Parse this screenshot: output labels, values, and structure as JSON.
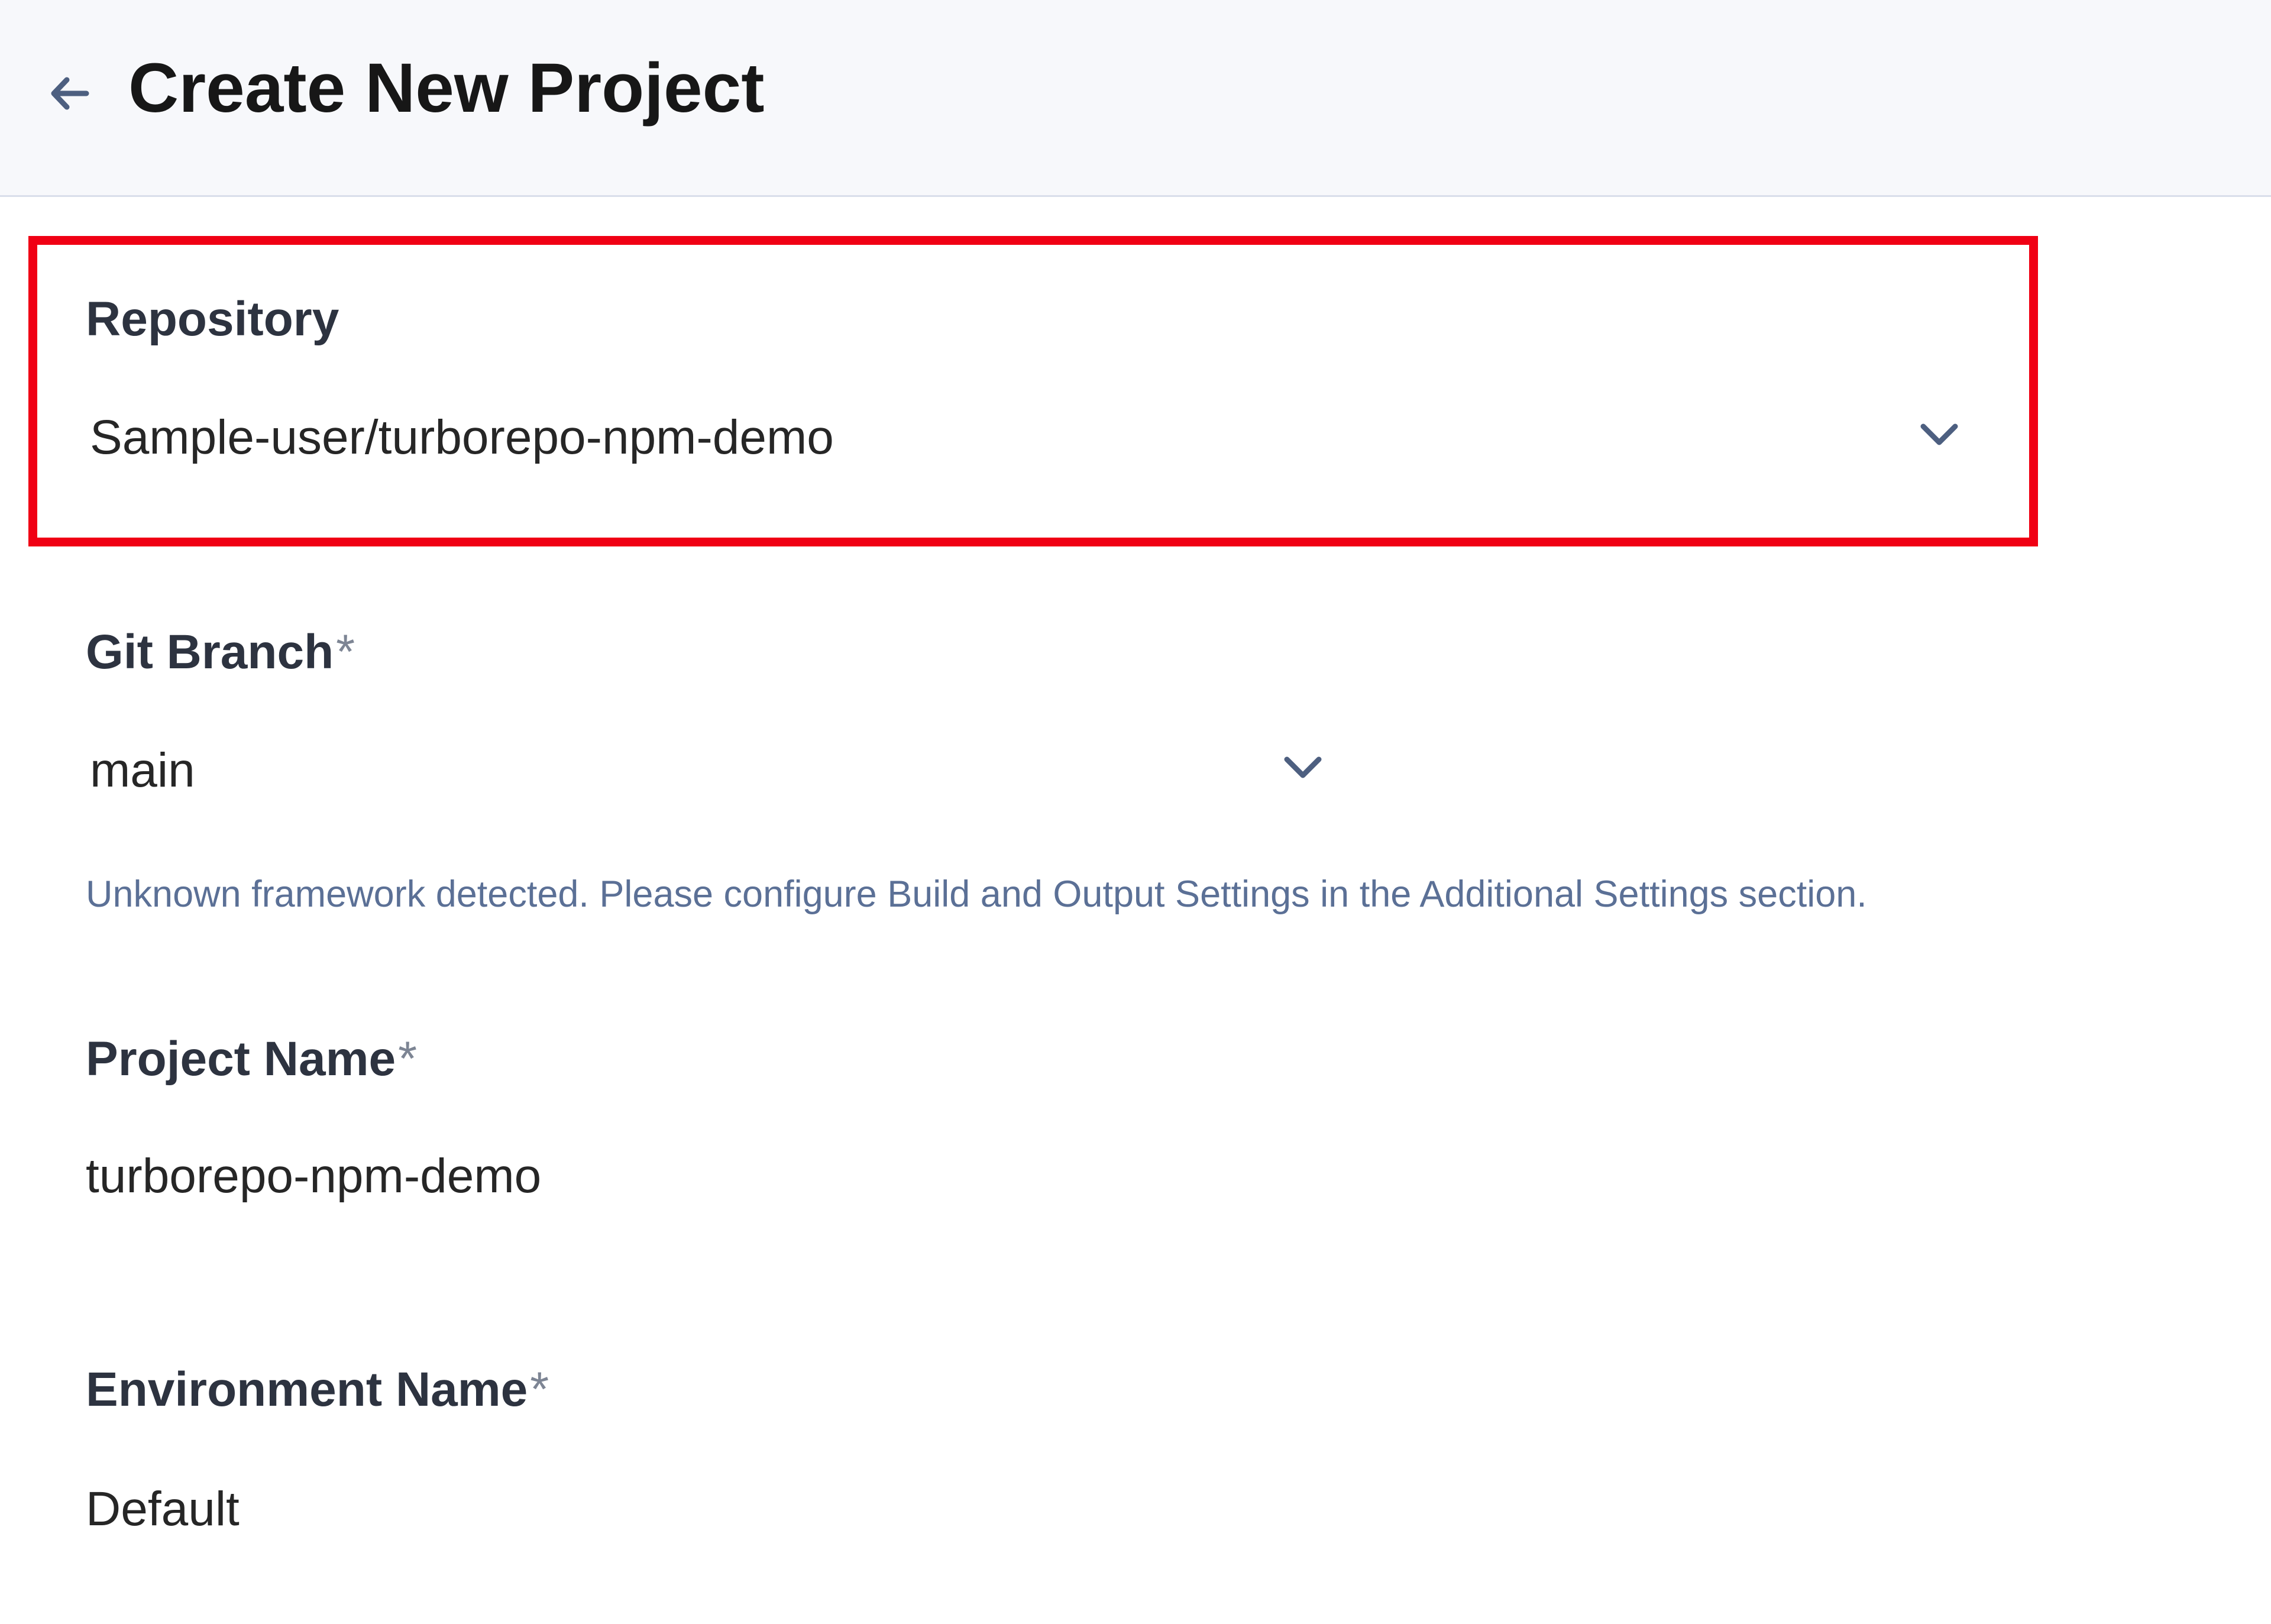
{
  "header": {
    "back_icon": "arrow-left-icon",
    "title": "Create New Project"
  },
  "form": {
    "repository": {
      "label": "Repository",
      "value": "Sample-user/turborepo-npm-demo",
      "icon": "chevron-down-icon",
      "highlighted": true,
      "highlight_color": "#f00014"
    },
    "git_branch": {
      "label": "Git Branch",
      "required": "*",
      "value": "main",
      "icon": "chevron-down-icon"
    },
    "framework_notice": "Unknown framework detected. Please configure Build and Output Settings in the Additional Settings section.",
    "project_name": {
      "label": "Project Name",
      "required": "*",
      "value": "turborepo-npm-demo"
    },
    "environment_name": {
      "label": "Environment Name",
      "required": "*",
      "value": "Default"
    }
  },
  "colors": {
    "header_background": "#f7f8fb",
    "icon_color": "#4d5f80",
    "notice_text": "#5b7096",
    "highlight_border": "#f00014"
  }
}
